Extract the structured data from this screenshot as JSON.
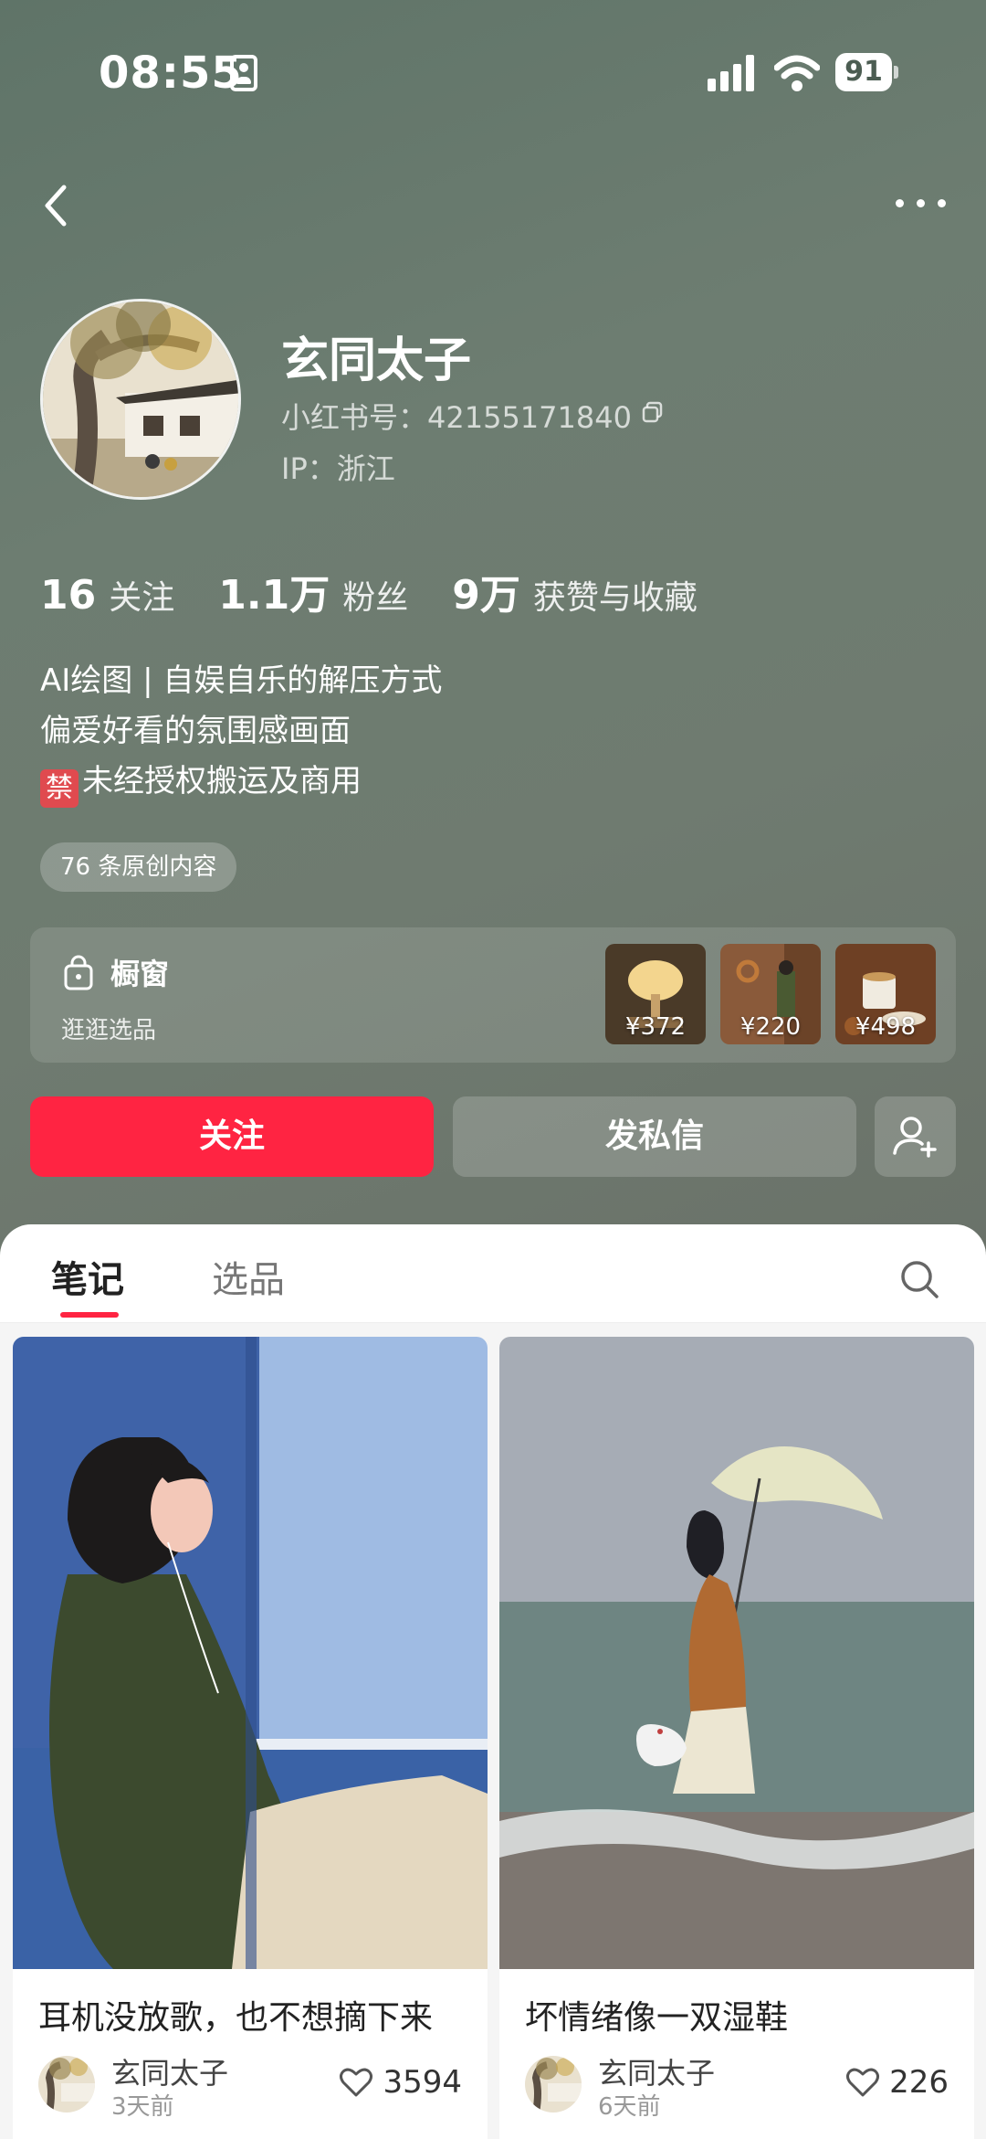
{
  "status_bar": {
    "time": "08:55",
    "battery": "91"
  },
  "profile": {
    "name": "玄同太子",
    "red_id": "小红书号：42155171840",
    "ip": "IP：浙江",
    "stats": [
      {
        "num": "16",
        "label": "关注"
      },
      {
        "num": "1.1万",
        "label": "粉丝"
      },
      {
        "num": "9万",
        "label": "获赞与收藏"
      }
    ],
    "bio": [
      "AI绘图 | 自娱自乐的解压方式",
      "偏爱好看的氛围感画面",
      "未经授权搬运及商用"
    ],
    "ban_glyph": "禁",
    "tag": "76 条原创内容"
  },
  "shop": {
    "title": "橱窗",
    "subtitle": "逛逛选品",
    "products": [
      {
        "price": "¥372",
        "color": "#c89a5e"
      },
      {
        "price": "¥220",
        "color": "#8a5a3a"
      },
      {
        "price": "¥498",
        "color": "#7a4a2a"
      }
    ]
  },
  "actions": {
    "follow": "关注",
    "message": "发私信"
  },
  "tabs": {
    "active": "笔记",
    "other": "选品"
  },
  "notes": [
    {
      "title": "耳机没放歌，也不想摘下来",
      "author": "玄同太子",
      "time": "3天前",
      "likes": "3594"
    },
    {
      "title": "坏情绪像一双湿鞋",
      "author": "玄同太子",
      "time": "6天前",
      "likes": "226"
    }
  ],
  "colors": {
    "accent": "#ff2442",
    "hero": "#6d7d71"
  }
}
